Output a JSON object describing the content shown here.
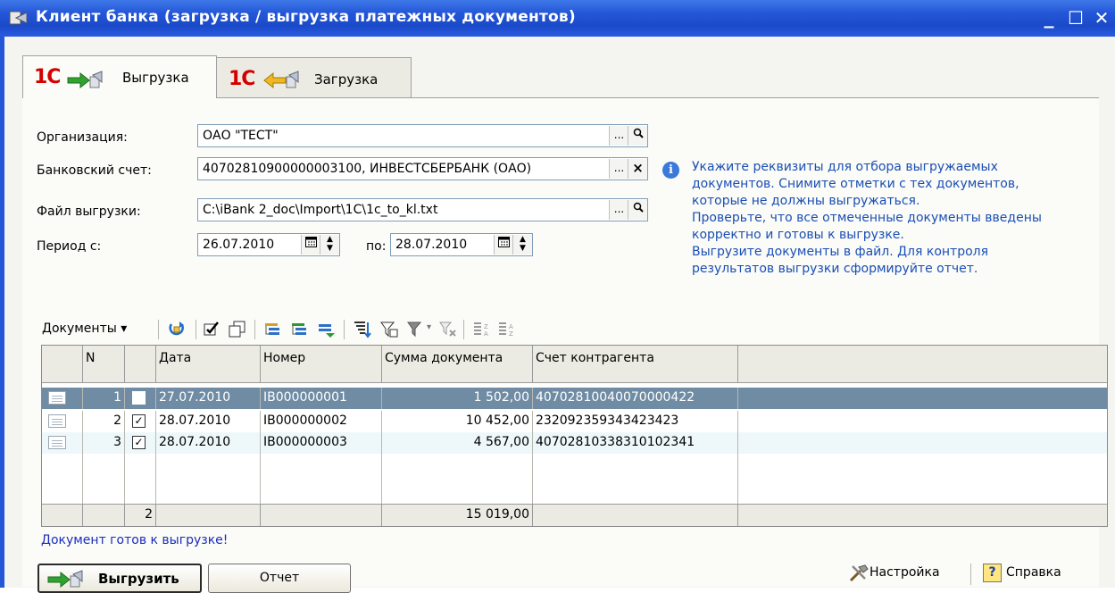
{
  "window": {
    "title": "Клиент банка (загрузка / выгрузка платежных документов)",
    "min": "_",
    "max": "☐",
    "close": "✕"
  },
  "tabs": [
    {
      "label": "Выгрузка",
      "logo": "1С",
      "active": true
    },
    {
      "label": "Загрузка",
      "logo": "1С",
      "active": false
    }
  ],
  "form": {
    "org_label": "Организация:",
    "org_value": "ОАО \"ТЕСТ\"",
    "account_label": "Банковский счет:",
    "account_value": "40702810900000003100, ИНВЕСТСБЕРБАНК (ОАО)",
    "file_label": "Файл выгрузки:",
    "file_value": "C:\\iBank 2_doc\\Import\\1C\\1c_to_kl.txt",
    "period_label": "Период с:",
    "period_from": "26.07.2010",
    "period_to_label": "по:",
    "period_to": "28.07.2010",
    "dots": "...",
    "clear": "×"
  },
  "info": {
    "lines": [
      "Укажите реквизиты для отбора выгружаемых",
      "документов. Снимите отметки с тех документов,",
      "которые не должны выгружаться.",
      "Проверьте, что все отмеченные документы введены",
      "корректно и готовы к выгрузке.",
      "Выгрузите документы в файл. Для контроля",
      "результатов выгрузки сформируйте отчет."
    ]
  },
  "toolbar": {
    "menu_label": "Документы ▾"
  },
  "table": {
    "headers": [
      "N",
      "",
      "Дата",
      "Номер",
      "Сумма документа",
      "Счет контрагента"
    ],
    "rows": [
      {
        "n": "1",
        "checked": false,
        "date": "27.07.2010",
        "number": "IB000000001",
        "sum": "1 502,00",
        "account": "40702810040070000422"
      },
      {
        "n": "2",
        "checked": true,
        "date": "28.07.2010",
        "number": "IB000000002",
        "sum": "10 452,00",
        "account": "232092359343423423"
      },
      {
        "n": "3",
        "checked": true,
        "date": "28.07.2010",
        "number": "IB000000003",
        "sum": "4 567,00",
        "account": "40702810338310102341"
      }
    ],
    "footer": {
      "count": "2",
      "total": "15 019,00"
    }
  },
  "status": "Документ готов к выгрузке!",
  "buttons": {
    "export": "Выгрузить",
    "report": "Отчет",
    "settings": "Настройка",
    "help": "Справка"
  },
  "colors": {
    "selected_row": "#6f8ca4",
    "alt_row": "#eef8fb",
    "link_blue": "#1a4fb5"
  }
}
